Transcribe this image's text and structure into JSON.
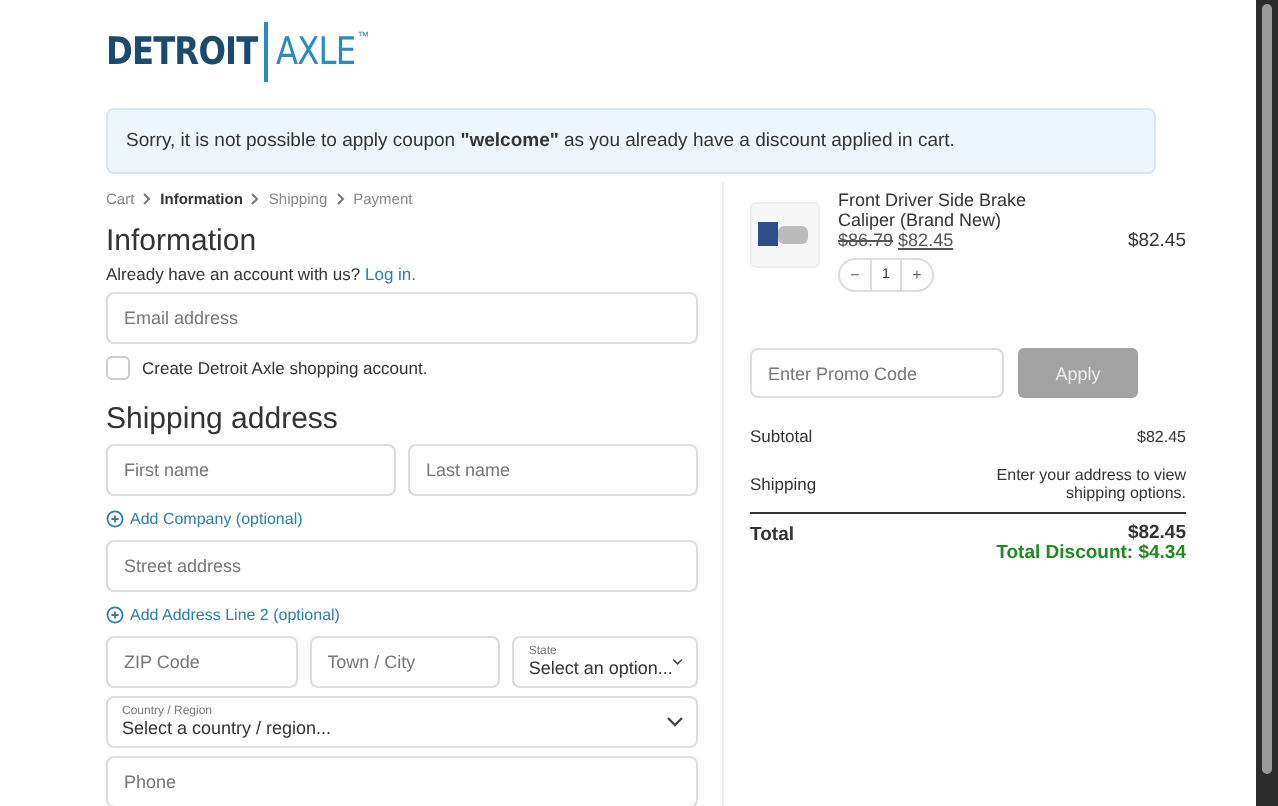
{
  "logo": {
    "left": "DETROIT",
    "right": "AXLE",
    "mark": "™"
  },
  "notice": "Sorry, it is not possible to apply coupon **\"welcome\"** as you already have a discount applied in cart.",
  "breadcrumb": [
    {
      "label": "Cart",
      "selected": false
    },
    {
      "label": "Information",
      "selected": true
    },
    {
      "label": "Shipping",
      "selected": false
    },
    {
      "label": "Payment",
      "selected": false
    }
  ],
  "information": {
    "title": "Information",
    "account_prompt": "Already have an account with us?",
    "login_link": "Log in.",
    "email_placeholder": "Email address",
    "create_account": {
      "label": "Create Detroit Axle shopping account.",
      "checked": false
    }
  },
  "shipping": {
    "title": "Shipping address",
    "rows": [
      [
        {
          "kind": "input",
          "placeholder": "First name"
        },
        {
          "kind": "input",
          "placeholder": "Last name"
        }
      ],
      [
        {
          "kind": "link",
          "label": "Add Company (optional)"
        }
      ],
      [
        {
          "kind": "input",
          "placeholder": "Street address"
        }
      ],
      [
        {
          "kind": "link",
          "label": "Add Address Line 2 (optional)"
        }
      ],
      [
        {
          "kind": "input",
          "placeholder": "ZIP Code"
        },
        {
          "kind": "input",
          "placeholder": "Town / City"
        },
        {
          "kind": "select",
          "label": "State",
          "value": "Select an option..."
        }
      ],
      [
        {
          "kind": "select",
          "label": "Country / Region",
          "value": "Select a country / region..."
        }
      ],
      [
        {
          "kind": "input",
          "placeholder": "Phone"
        }
      ]
    ]
  },
  "cart": {
    "item": {
      "name": "Front Driver Side Brake Caliper (Brand New)",
      "old_price": "$86.79",
      "price": "$82.45",
      "quantity": "1",
      "minus": "−",
      "plus": "+",
      "line_total": "$82.45"
    },
    "promo": {
      "placeholder": "Enter Promo Code",
      "button": "Apply",
      "disabled": true
    },
    "summary": [
      {
        "label": "Subtotal",
        "value": "$82.45"
      },
      {
        "label": "Shipping",
        "value": "Enter your address to view shipping options."
      }
    ],
    "total": {
      "label": "Total",
      "value": "$82.45",
      "discount": "Total Discount: $4.34"
    }
  }
}
